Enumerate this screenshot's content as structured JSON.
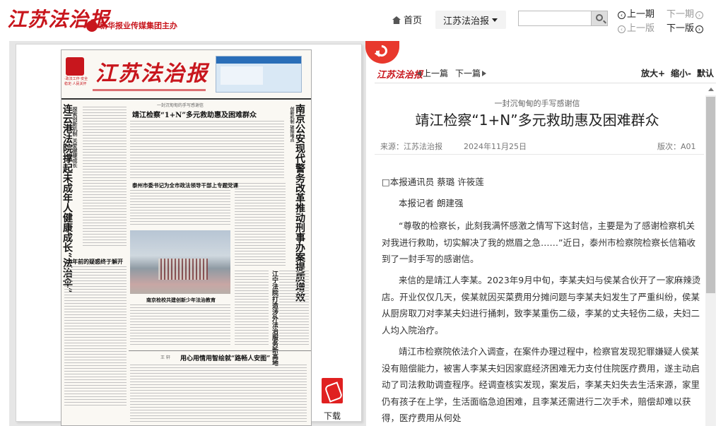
{
  "brand": {
    "logo": "江苏法治报",
    "sponsor": "新华报业传媒集团主办"
  },
  "nav": {
    "home": "首页",
    "edition_select": "江苏法治报",
    "search_placeholder": "",
    "prev_issue": "上一期",
    "next_issue": "下一期",
    "prev_page": "上一版",
    "next_page": "下一版"
  },
  "newspaper": {
    "masthead": "江苏法治报",
    "tagline": "·政法工作·安全稳定·人民关怀",
    "top_banner": "一封沉甸甸的手写感谢信",
    "headline_main": "靖江检察“1+N”多元救助惠及困难群众",
    "vertical_left": "连云港法院撑起未成年人健康成长“法治伞”",
    "vertical_left_kicker": "探索创新机制 关爱健康成长",
    "vertical_right": "南京公安现代警务改革推动刑事办案提质增效",
    "vertical_right_kicker": "创新机制 破除堵点",
    "subhead_1": "泰州市委书记为全市政法领导干部上专题党课",
    "photo_caption": "南京检校共建创新少年法治教育",
    "small_head": "26年前的疑惑终于解开",
    "vertical_mid": "江宁法院打造涉外法治服务新高地",
    "bottom_head": "用心用情用智绘就“路畅人安图”",
    "bottom_kicker": "王   轩"
  },
  "download": {
    "label": "下载"
  },
  "article_toolbar": {
    "logo": "江苏法治报",
    "prev": "上一篇",
    "next": "下一篇",
    "zoom_in": "放大+",
    "zoom_out": "缩小-",
    "default": "默认"
  },
  "article": {
    "subtitle": "一封沉甸甸的手写感谢信",
    "title": "靖江检察“1+N”多元救助惠及困难群众",
    "source": "来源：江苏法治报",
    "date": "2024年11月25日",
    "page": "版次：A01",
    "byline_1": "□本报通讯员 蔡璐 许筱莲",
    "byline_2": "本报记者 朗建强",
    "paragraphs": [
      "“尊敬的检察长，此刻我满怀感激之情写下这封信，主要是为了感谢检察机关对我进行救助，切实解决了我的燃眉之急……”近日，泰州市检察院检察长信箱收到了一封手写的感谢信。",
      "来信的是靖江人李某。2023年9月中旬，李某夫妇与侯某合伙开了一家麻辣烫店。开业仅仅几天，侯某就因买菜费用分摊问题与李某夫妇发生了严重纠纷，侯某从厨房取刀对李某夫妇进行捅刺，致李某重伤二级，李某的丈夫轻伤二级，夫妇二人均入院治疗。",
      "靖江市检察院依法介入调查，在案件办理过程中，检察官发现犯罪嫌疑人侯某没有赔偿能力，被害人李某夫妇因家庭经济困难无力支付住院医疗费用，遂主动启动了司法救助调查程序。经调查核实发现，案发后，李某夫妇失去生活来源，家里仍有孩子在上学，生活面临急迫困难，且李某还需进行二次手术，赔偿却难以获得，医疗费用从何处"
    ]
  }
}
